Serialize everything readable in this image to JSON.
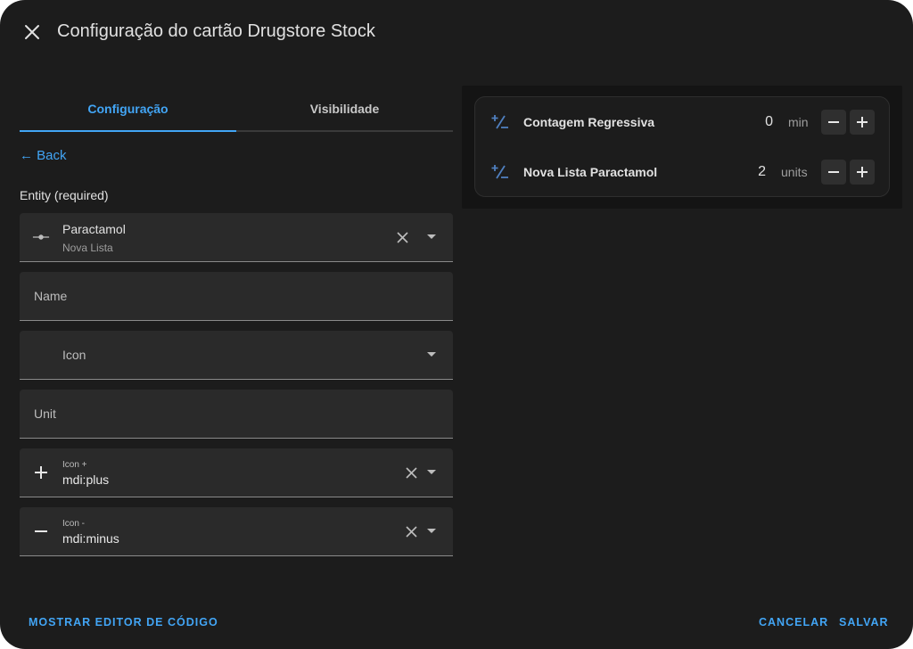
{
  "dialog": {
    "title": "Configuração do cartão Drugstore Stock"
  },
  "tabs": [
    {
      "label": "Configuração",
      "active": true
    },
    {
      "label": "Visibilidade",
      "active": false
    }
  ],
  "back_label": "← Back",
  "entity_section_label": "Entity (required)",
  "entity": {
    "name": "Paractamol",
    "secondary": "Nova Lista",
    "icon": "entity-icon"
  },
  "fields": {
    "name_placeholder": "Name",
    "icon_placeholder": "Icon",
    "unit_placeholder": "Unit",
    "icon_plus": {
      "label": "Icon +",
      "value": "mdi:plus",
      "icon": "plus-icon"
    },
    "icon_minus": {
      "label": "Icon -",
      "value": "mdi:minus",
      "icon": "minus-icon"
    }
  },
  "preview": {
    "rows": [
      {
        "name": "Contagem Regressiva",
        "value": "0",
        "unit": "min",
        "icon": "plus-minus-icon"
      },
      {
        "name": "Nova Lista Paractamol",
        "value": "2",
        "unit": "units",
        "icon": "plus-minus-icon"
      }
    ]
  },
  "footer": {
    "show_code_editor": "MOSTRAR EDITOR DE CÓDIGO",
    "cancel": "CANCELAR",
    "save": "SALVAR"
  },
  "colors": {
    "accent": "#42a5f5",
    "dialog_bg": "#1c1c1c",
    "field_bg": "#2a2a2a",
    "preview_icon": "#4f7fbf"
  }
}
